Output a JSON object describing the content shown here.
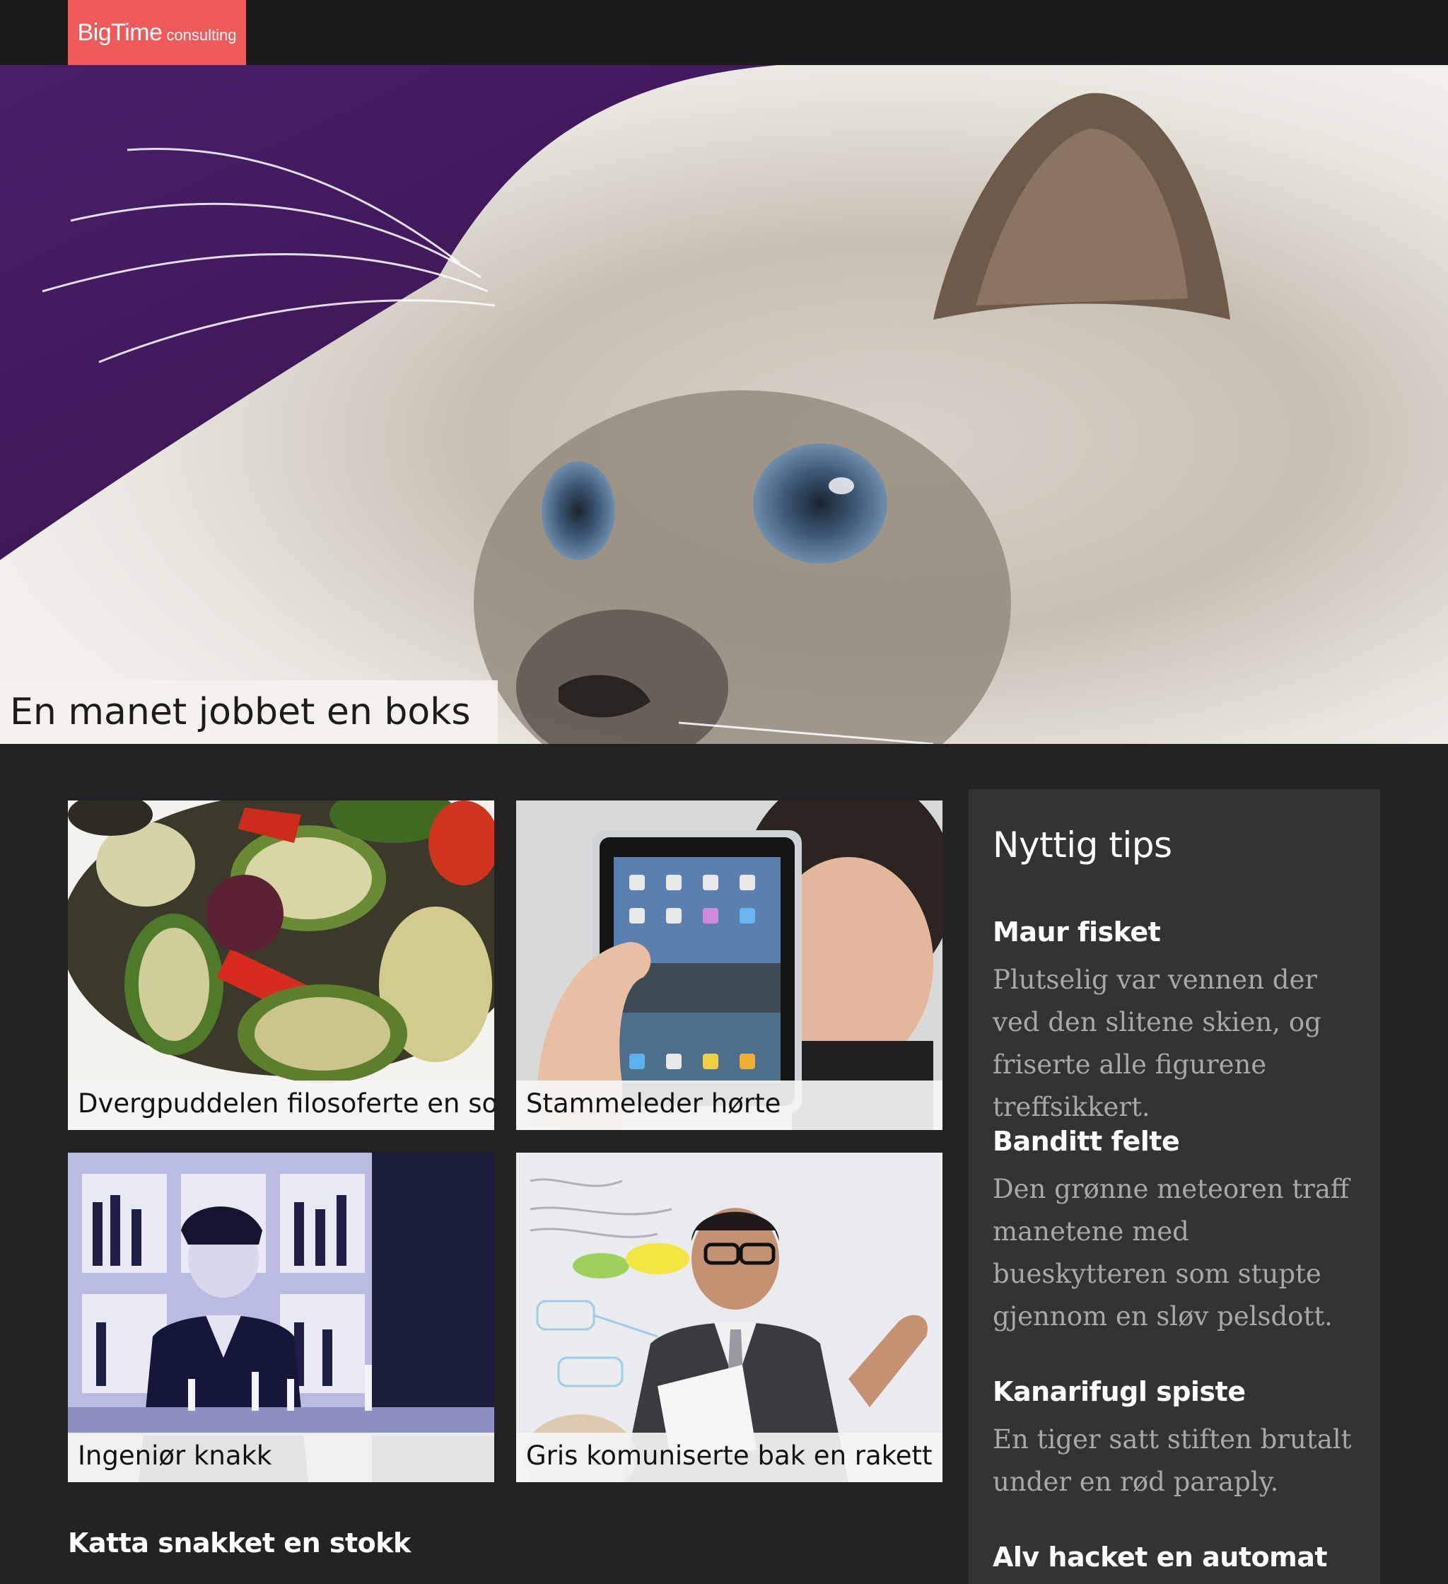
{
  "header": {
    "logo_main": "BigTime",
    "logo_sub": "consulting",
    "logo_color": "#f05a5a"
  },
  "hero": {
    "caption": "En manet jobbet en boks",
    "image": "blue-eyed-cat-photo"
  },
  "cards": [
    {
      "caption": "Dvergpuddelen filosoferte en sofa",
      "image": "grilled-vegetables-photo"
    },
    {
      "caption": "Stammeleder hørte",
      "image": "man-holding-tablet-photo"
    },
    {
      "caption": "Ingeniør knakk",
      "image": "bartender-photo"
    },
    {
      "caption": "Gris komuniserte bak en rakett",
      "image": "man-presenting-whiteboard-photo"
    }
  ],
  "bottom_heading": "Katta snakket en stokk",
  "sidebar": {
    "title": "Nyttig tips",
    "tips": [
      {
        "title": "Maur fisket",
        "text": "Plutselig var vennen der ved den slitene skien, og friserte alle figurene treffsikkert."
      },
      {
        "title": "Banditt felte",
        "text": "Den grønne meteoren traff manetene med bueskytteren som stupte gjennom en sløv pelsdott."
      },
      {
        "title": "Kanarifugl spiste",
        "text": "En tiger satt stiften brutalt under en rød paraply."
      },
      {
        "title": "Alv hacket en automat",
        "text": ""
      }
    ]
  }
}
